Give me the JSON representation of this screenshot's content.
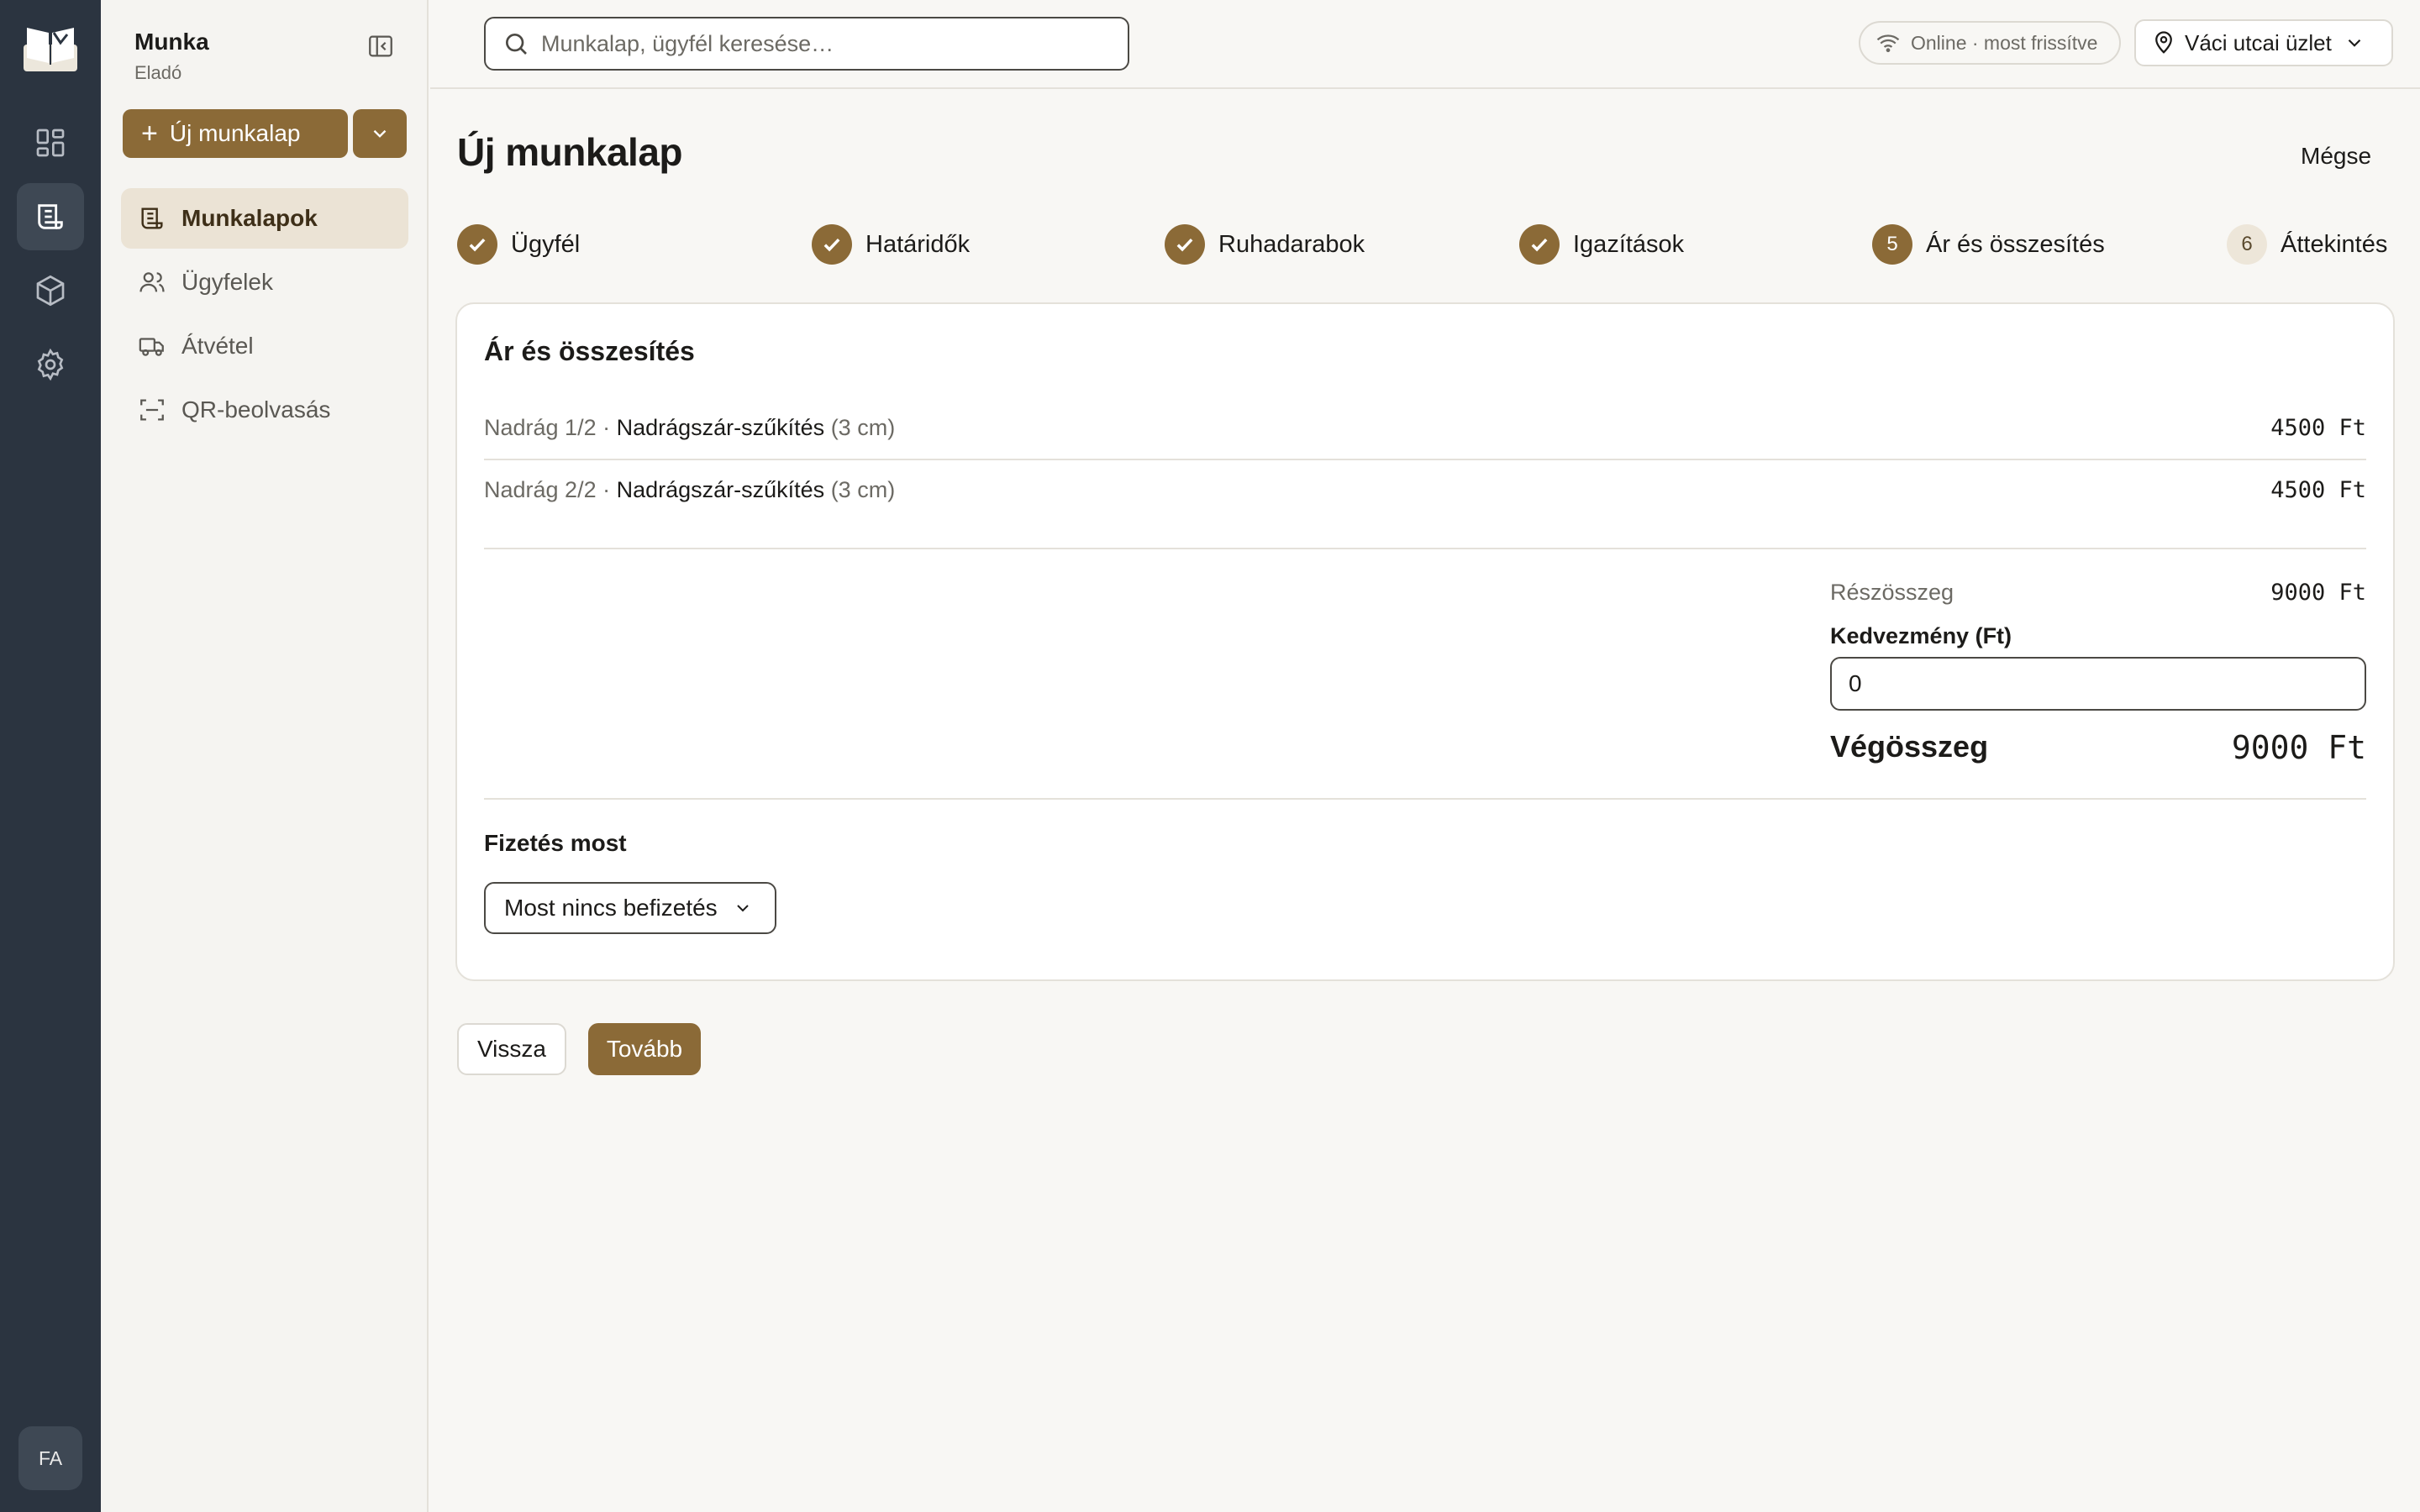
{
  "rail": {
    "avatar_initials": "FA",
    "items": [
      "dashboard-icon",
      "worksheet-icon",
      "package-icon",
      "gear-icon"
    ],
    "active_index": 1
  },
  "sidebar": {
    "title": "Munka",
    "subtitle": "Eladó",
    "new_button_label": "Új munkalap",
    "nav": [
      {
        "label": "Munkalapok",
        "icon": "worksheet-icon",
        "active": true
      },
      {
        "label": "Ügyfelek",
        "icon": "users-icon",
        "active": false
      },
      {
        "label": "Átvétel",
        "icon": "truck-icon",
        "active": false
      },
      {
        "label": "QR-beolvasás",
        "icon": "scan-icon",
        "active": false
      }
    ]
  },
  "topbar": {
    "search_placeholder": "Munkalap, ügyfél keresése…",
    "status_text": "Online · most frissítve",
    "store_label": "Váci utcai üzlet"
  },
  "page": {
    "title": "Új munkalap",
    "cancel_label": "Mégse"
  },
  "steps": [
    {
      "label": "Ügyfél",
      "state": "done"
    },
    {
      "label": "Határidők",
      "state": "done"
    },
    {
      "label": "Ruhadarabok",
      "state": "done"
    },
    {
      "label": "Igazítások",
      "state": "done"
    },
    {
      "label": "Ár és összesítés",
      "state": "current",
      "number": "5"
    },
    {
      "label": "Áttekintés",
      "state": "todo",
      "number": "6"
    }
  ],
  "card": {
    "title": "Ár és összesítés",
    "lines": [
      {
        "item": "Nadrág 1/2 · ",
        "service": "Nadrágszár-szűkítés",
        "detail": " (3 cm)",
        "price": "4500 Ft"
      },
      {
        "item": "Nadrág 2/2 · ",
        "service": "Nadrágszár-szűkítés",
        "detail": " (3 cm)",
        "price": "4500 Ft"
      }
    ],
    "subtotal_label": "Részösszeg",
    "subtotal_value": "9000 Ft",
    "discount_label": "Kedvezmény (Ft)",
    "discount_value": "0",
    "total_label": "Végösszeg",
    "total_value": "9000 Ft",
    "payment_label": "Fizetés most",
    "payment_selected": "Most nincs befizetés"
  },
  "footer": {
    "back_label": "Vissza",
    "next_label": "Tovább"
  },
  "colors": {
    "accent": "#8b6a37",
    "rail_bg": "#2b3440",
    "active_nav_bg": "#ebe3d5"
  }
}
